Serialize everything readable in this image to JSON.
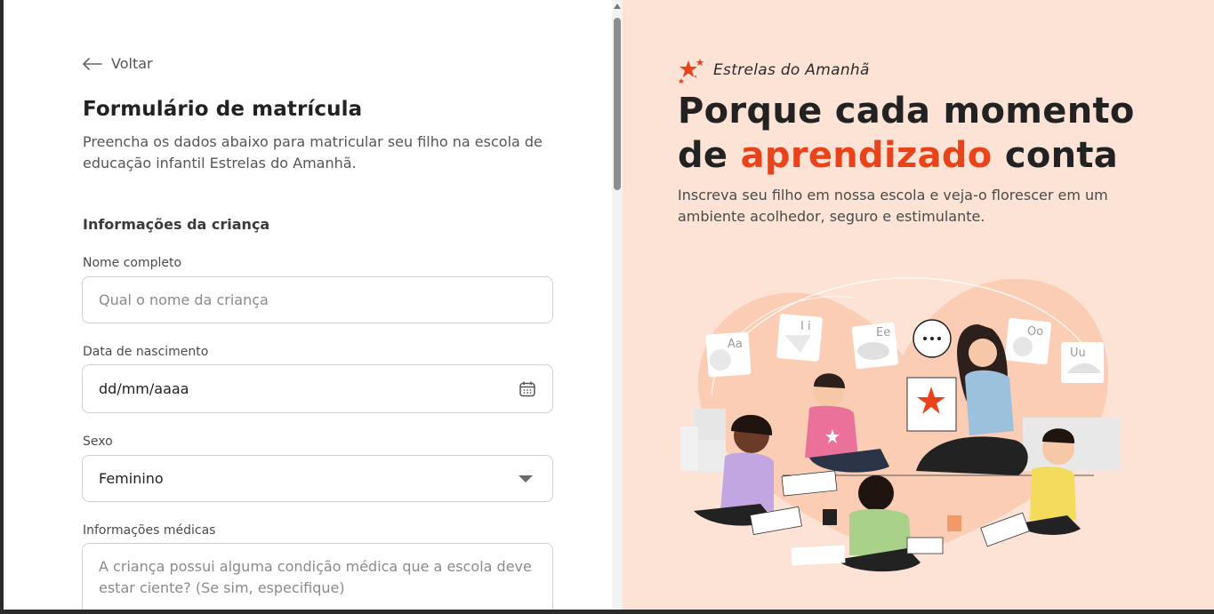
{
  "form": {
    "back_label": "Voltar",
    "title": "Formulário de matrícula",
    "subtitle": "Preencha os dados abaixo para matricular seu filho na escola de educação infantil Estrelas do Amanhã.",
    "section_child": "Informações da criança",
    "name": {
      "label": "Nome completo",
      "placeholder": "Qual o nome da criança"
    },
    "birth": {
      "label": "Data de nascimento",
      "value": "dd/mm/aaaa"
    },
    "sex": {
      "label": "Sexo",
      "value": "Feminino"
    },
    "medical": {
      "label": "Informações médicas",
      "placeholder": "A criança possui alguma condição médica que a escola deve estar ciente? (Se sim, especifique)"
    }
  },
  "hero": {
    "brand": "Estrelas do Amanhã",
    "headline_part1": "Porque cada momento de ",
    "headline_accent": "aprendizado",
    "headline_part2": " conta",
    "lead": "Inscreva seu filho em nossa escola e veja-o florescer em um ambiente acolhedor, seguro e estimulante."
  },
  "icons": [
    "arrow-left-icon",
    "calendar-icon",
    "chevron-down-icon",
    "star-logo-icon"
  ],
  "colors": {
    "accent": "#e8431a",
    "hero_bg": "#fde3d5"
  }
}
